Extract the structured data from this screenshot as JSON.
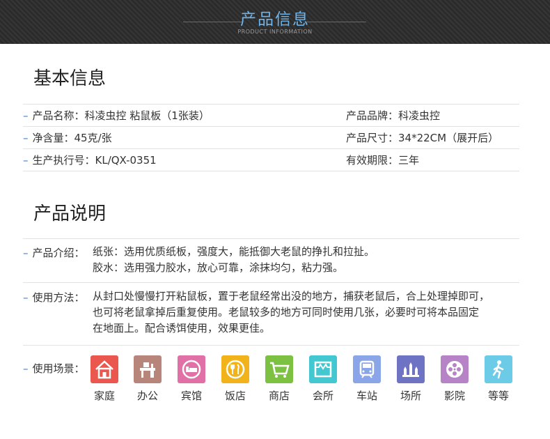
{
  "header": {
    "title": "产品信息",
    "subtitle": "PRODUCT INFORMATION"
  },
  "basic": {
    "title": "基本信息",
    "rows": [
      {
        "left": "产品名称：科凌虫控 粘鼠板（1张装）",
        "right": "产品品牌：科凌虫控"
      },
      {
        "left": "净含量：45克/张",
        "right": "产品尺寸：34*22CM（展开后）"
      },
      {
        "left": "生产执行号：KL/QX-0351",
        "right": "有效期限：三年"
      }
    ]
  },
  "desc": {
    "title": "产品说明",
    "intro_label": "产品介绍：",
    "intro_lines": [
      "纸张：选用优质纸板，强度大，能抵御大老鼠的挣扎和拉扯。",
      "胶水：选用强力胶水，放心可靠，涂抹均匀，粘力强。"
    ],
    "usage_label": "使用方法：",
    "usage_lines": [
      "从封口处慢慢打开粘鼠板，置于老鼠经常出没的地方，捕获老鼠后，合上处理掉即可，",
      "也可将老鼠拿掉后重复使用。老鼠较多的地方可同时使用几张，必要时可将本品固定",
      "在地面上。配合诱饵使用，效果更佳。"
    ],
    "scene_label": "使用场景：",
    "scenes": [
      {
        "label": "家庭",
        "icon": "house-icon",
        "color": "#e9574f"
      },
      {
        "label": "办公",
        "icon": "office-icon",
        "color": "#b7857a"
      },
      {
        "label": "宾馆",
        "icon": "bed-icon",
        "color": "#e070a6"
      },
      {
        "label": "饭店",
        "icon": "dining-icon",
        "color": "#f2b21a"
      },
      {
        "label": "商店",
        "icon": "cart-icon",
        "color": "#7cc142"
      },
      {
        "label": "会所",
        "icon": "club-icon",
        "color": "#43c7d0"
      },
      {
        "label": "车站",
        "icon": "train-icon",
        "color": "#8aa6e8"
      },
      {
        "label": "场所",
        "icon": "venue-icon",
        "color": "#6f73c4"
      },
      {
        "label": "影院",
        "icon": "film-reel-icon",
        "color": "#b683c6"
      },
      {
        "label": "等等",
        "icon": "exit-person-icon",
        "color": "#6ccbe6"
      }
    ]
  }
}
